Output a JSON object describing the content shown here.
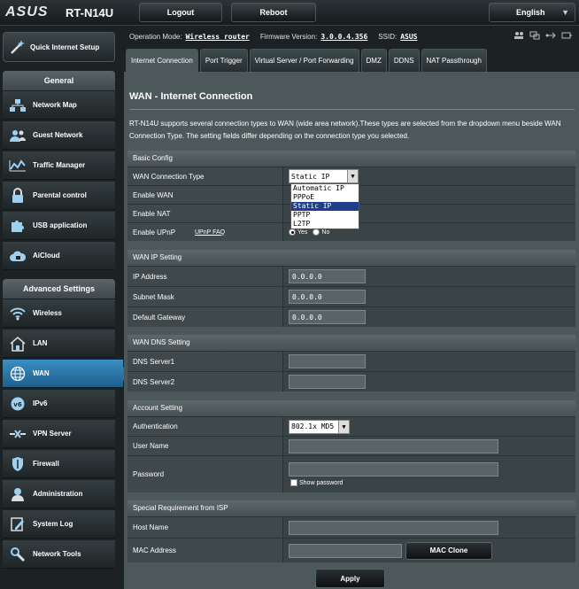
{
  "header": {
    "brand": "ASUS",
    "model": "RT-N14U",
    "logout_label": "Logout",
    "reboot_label": "Reboot",
    "language": "English"
  },
  "sidebar": {
    "quick_setup": "Quick Internet Setup",
    "general_title": "General",
    "general_items": [
      {
        "label": "Network Map",
        "icon": "network-map-icon"
      },
      {
        "label": "Guest Network",
        "icon": "guest-network-icon"
      },
      {
        "label": "Traffic Manager",
        "icon": "traffic-manager-icon"
      },
      {
        "label": "Parental control",
        "icon": "lock-icon"
      },
      {
        "label": "USB application",
        "icon": "puzzle-icon"
      },
      {
        "label": "AiCloud",
        "icon": "cloud-icon"
      }
    ],
    "advanced_title": "Advanced Settings",
    "advanced_items": [
      {
        "label": "Wireless",
        "icon": "wifi-icon"
      },
      {
        "label": "LAN",
        "icon": "home-icon"
      },
      {
        "label": "WAN",
        "icon": "globe-icon"
      },
      {
        "label": "IPv6",
        "icon": "ipv6-icon"
      },
      {
        "label": "VPN Server",
        "icon": "vpn-icon"
      },
      {
        "label": "Firewall",
        "icon": "shield-icon"
      },
      {
        "label": "Administration",
        "icon": "user-icon"
      },
      {
        "label": "System Log",
        "icon": "log-icon"
      },
      {
        "label": "Network Tools",
        "icon": "tools-icon"
      }
    ]
  },
  "status": {
    "op_mode_label": "Operation Mode:",
    "op_mode_value": "Wireless router",
    "fw_label": "Firmware Version:",
    "fw_value": "3.0.0.4.356",
    "ssid_label": "SSID:",
    "ssid_value": "ASUS"
  },
  "tabs": [
    "Internet Connection",
    "Port Trigger",
    "Virtual Server / Port Forwarding",
    "DMZ",
    "DDNS",
    "NAT Passthrough"
  ],
  "page": {
    "title": "WAN - Internet Connection",
    "description": "RT-N14U supports several connection types to WAN (wide area network).These types are selected from the dropdown menu beside WAN Connection Type. The setting fields differ depending on the connection type you selected."
  },
  "basic": {
    "title": "Basic Config",
    "wan_type_label": "WAN Connection Type",
    "wan_type_value": "Static IP",
    "wan_type_options": [
      "Automatic IP",
      "PPPoE",
      "Static IP",
      "PPTP",
      "L2TP"
    ],
    "enable_wan_label": "Enable WAN",
    "enable_nat_label": "Enable NAT",
    "enable_upnp_label": "Enable UPnP",
    "upnp_faq": "UPnP FAQ",
    "yes": "Yes",
    "no": "No"
  },
  "wan_ip": {
    "title": "WAN IP Setting",
    "ip_label": "IP Address",
    "ip_value": "0.0.0.0",
    "mask_label": "Subnet Mask",
    "mask_value": "0.0.0.0",
    "gw_label": "Default Gateway",
    "gw_value": "0.0.0.0"
  },
  "dns": {
    "title": "WAN DNS Setting",
    "dns1_label": "DNS Server1",
    "dns2_label": "DNS Server2"
  },
  "account": {
    "title": "Account Setting",
    "auth_label": "Authentication",
    "auth_value": "802.1x MD5",
    "user_label": "User Name",
    "pass_label": "Password",
    "show_password": "Show password"
  },
  "isp": {
    "title": "Special Requirement from ISP",
    "host_label": "Host Name",
    "mac_label": "MAC Address",
    "mac_clone": "MAC Clone"
  },
  "apply_label": "Apply"
}
